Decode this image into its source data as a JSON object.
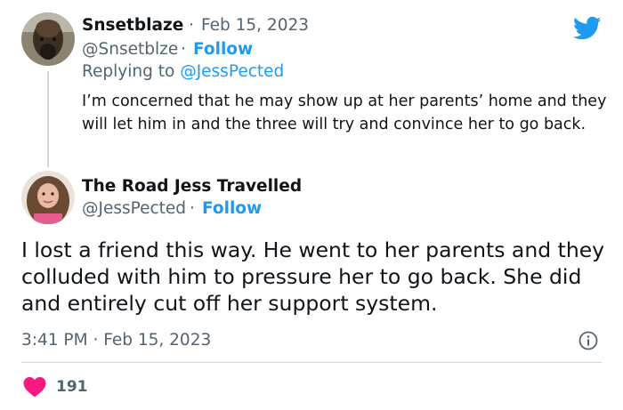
{
  "reply": {
    "author_name": "Snsetblaze",
    "separator": "·",
    "date": "Feb 15, 2023",
    "handle": "@Snsetblze",
    "follow_label": "Follow",
    "replying_to_prefix": "Replying to",
    "replying_to_handle": "@JessPected",
    "text": "I’m concerned that he may show up at her parents’ home and they will let him in and the three will try and convince her to go back."
  },
  "tweet": {
    "author_name": "The Road Jess Travelled",
    "handle": "@JessPected",
    "separator": "·",
    "follow_label": "Follow",
    "text": "I lost a friend this way. He went to her parents and they colluded with him to pressure her to go back. She did and entirely cut off her support system.",
    "time": "3:41 PM",
    "date": "Feb 15, 2023",
    "like_count": "191"
  },
  "icons": {
    "brand": "twitter-bird-icon",
    "info": "info-icon",
    "like": "heart-icon"
  },
  "colors": {
    "accent": "#1d9bf0",
    "muted": "#536471",
    "like": "#f91880",
    "divider": "#cfd9de"
  }
}
